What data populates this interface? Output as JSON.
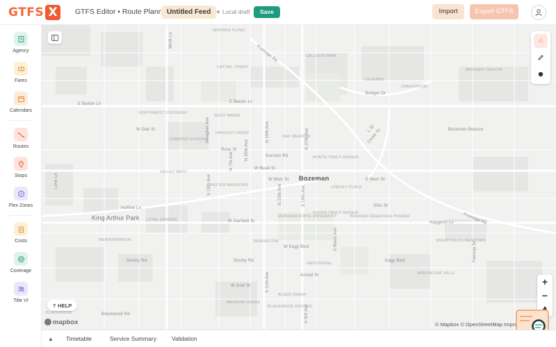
{
  "header": {
    "logo_text": "GTFS",
    "logo_x": "X",
    "app_title": "GTFS Editor • Route Planner",
    "feed_name": "Untitled Feed",
    "draft_status": "Local draft",
    "save_label": "Save",
    "import_label": "Import",
    "export_label": "Export GTFS"
  },
  "sidebar": {
    "items": [
      {
        "label": "Agency",
        "icon": "building-icon",
        "bg": "#dff3ec",
        "fg": "#2f9e7d"
      },
      {
        "label": "Fares",
        "icon": "ticket-icon",
        "bg": "#fdf0d6",
        "fg": "#d9962a"
      },
      {
        "label": "Calendars",
        "icon": "calendar-icon",
        "bg": "#fdead8",
        "fg": "#e0882e"
      },
      {
        "label": "Routes",
        "icon": "route-icon",
        "bg": "#fde3dc",
        "fg": "#e8634a"
      },
      {
        "label": "Stops",
        "icon": "pin-icon",
        "bg": "#fde3dc",
        "fg": "#e8634a"
      },
      {
        "label": "Flex Zones",
        "icon": "hexagon-icon",
        "bg": "#ece6fb",
        "fg": "#7e63d6"
      },
      {
        "label": "Costs",
        "icon": "clipboard-icon",
        "bg": "#fdf0d6",
        "fg": "#d9962a"
      },
      {
        "label": "Coverage",
        "icon": "target-icon",
        "bg": "#dff3ec",
        "fg": "#2f9e7d"
      },
      {
        "label": "Title VI",
        "icon": "people-icon",
        "bg": "#ece6fb",
        "fg": "#7e63d6"
      }
    ]
  },
  "map": {
    "city_label": "Bozeman",
    "towns": [
      "King Arthur Park"
    ],
    "streets": [
      "E Baxter Ln",
      "W Oak St",
      "E Baxter Ln",
      "Frontage Rd",
      "Bridger Dr",
      "Bozeman Beacon",
      "Durston Rd",
      "Rose St",
      "W Beall St",
      "W Main St",
      "E Main St",
      "Ellis St",
      "Haggerty Ln",
      "Frontage Rd",
      "Huffine Ln",
      "W Garfield St",
      "W Kagy Blvd",
      "Kagy Blvd",
      "Stucky Rd",
      "Stucky Rd",
      "Arnold St",
      "W Graf St",
      "Blackwood Rd",
      "Love Ln",
      "Cedar St",
      "L St",
      "Wirth Ln",
      "N 19th Ave",
      "N 27th Ave",
      "N 25th Ave",
      "N 7th Ave",
      "N 15th Ave",
      "S 11th Ave",
      "S 19th Ave",
      "S 3rd Ave",
      "S 19th Ave",
      "S Black Ave",
      "Meagher Ave",
      "Fairway Dr"
    ],
    "districts": [
      "Bridger Canyon",
      "Gallatin Park",
      "Legends",
      "Creekwood",
      "Cattail Creek",
      "Springs Clinic",
      "Northwest Crossing",
      "West Winds",
      "Harvest Creek",
      "Diamond Estates",
      "Oak Meadow",
      "North Tracy Avenue",
      "Valley West",
      "Baxter Meadows",
      "Lindley Place",
      "South Tracy Avenue",
      "Montana State University",
      "Bozeman Deaconess Hospital",
      "Loyal Garden",
      "Meadowbrook",
      "Remington",
      "Mount Ellis Meadows",
      "Westridge",
      "Arrowleaf Hills",
      "Meadow Creek",
      "Alder Creek",
      "Blackwood Groves",
      "Blackwood"
    ],
    "help_label": "HELP",
    "help_glyph": "?",
    "mapbox_label": "mapbox",
    "attribution": "© Mapbox © OpenStreetMap Improve this map",
    "zoom_in": "+",
    "zoom_out": "−",
    "draw_tools": [
      "line-tool-icon",
      "pencil-icon",
      "point-icon"
    ]
  },
  "bottom": {
    "collapse_glyph": "▲",
    "tabs": [
      "Timetable",
      "Service Summary",
      "Validation"
    ]
  },
  "colors": {
    "accent": "#ef5a2f",
    "save": "#1f9c7d",
    "map_bg": "#f1f1f0"
  }
}
